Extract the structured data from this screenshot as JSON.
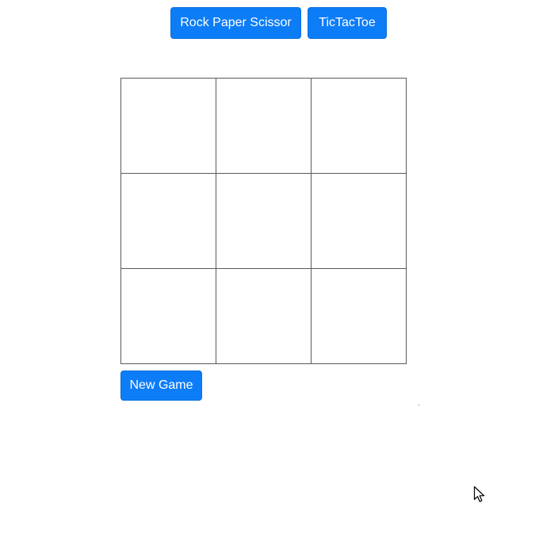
{
  "nav": {
    "buttons": [
      {
        "label": "Rock Paper Scissor"
      },
      {
        "label": "TicTacToe"
      }
    ]
  },
  "board": {
    "cells": [
      "",
      "",
      "",
      "",
      "",
      "",
      "",
      "",
      ""
    ]
  },
  "actions": {
    "new_game_label": "New Game"
  },
  "theme": {
    "accent": "#0d7df7",
    "grid_line": "#5a5a5a"
  },
  "icons": {
    "cursor": "mouse-pointer-icon"
  }
}
